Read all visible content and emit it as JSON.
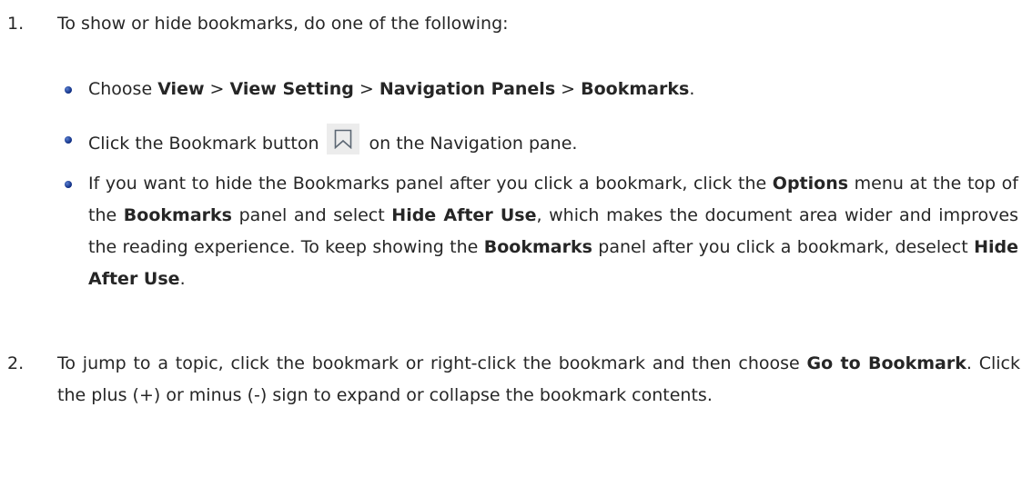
{
  "steps": [
    {
      "number": "1.",
      "text": "To show or hide bookmarks, do one of the following:",
      "bullets": [
        {
          "p1": "Choose ",
          "b1": "View",
          "p2": " > ",
          "b2": "View Setting",
          "p3": " > ",
          "b3": "Navigation Panels",
          "p4": " > ",
          "b4": "Bookmarks",
          "p5": "."
        },
        {
          "p1": "Click the Bookmark button",
          "icon": "bookmark-icon",
          "p2": "on the Navigation pane."
        },
        {
          "p1": "If you want to hide the Bookmarks panel after you click a bookmark, click the ",
          "b1": "Options",
          "p2": " menu at the top of the ",
          "b2": "Bookmarks",
          "p3": " panel and select ",
          "b3": "Hide After Use",
          "p4": ", which makes the document area wider and improves the reading experience. To keep showing the ",
          "b4": "Bookmarks",
          "p5": " panel after you click a bookmark, deselect ",
          "b5": "Hide After Use",
          "p6": "."
        }
      ]
    },
    {
      "number": "2.",
      "p1": "To jump to a topic, click the bookmark or right-click the bookmark and then choose ",
      "b1": "Go to Bookmark",
      "p2": ". Click the plus (+) or minus (-) sign to expand or collapse the bookmark contents."
    }
  ]
}
